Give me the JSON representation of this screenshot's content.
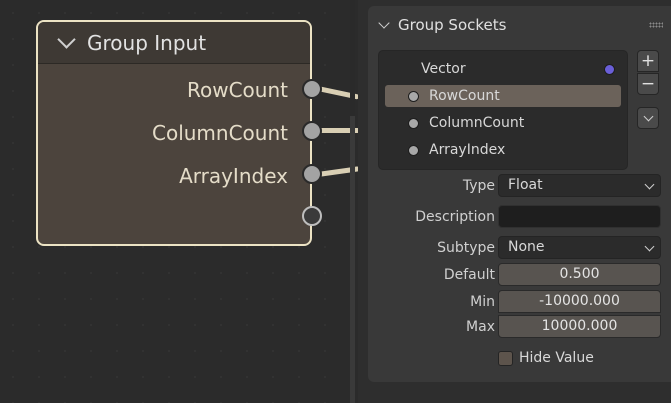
{
  "node": {
    "title": "Group Input",
    "outputs": [
      "RowCount",
      "ColumnCount",
      "ArrayIndex"
    ]
  },
  "panel": {
    "section_title": "Group Sockets",
    "sockets": [
      {
        "label": "Vector",
        "dot_color": "#6a5fd8"
      },
      {
        "label": "RowCount",
        "selected": true
      },
      {
        "label": "ColumnCount"
      },
      {
        "label": "ArrayIndex"
      }
    ],
    "buttons": {
      "add": "+",
      "remove": "−"
    },
    "properties": {
      "type_label": "Type",
      "type_value": "Float",
      "description_label": "Description",
      "description_value": "",
      "subtype_label": "Subtype",
      "subtype_value": "None",
      "default_label": "Default",
      "default_value": "0.500",
      "min_label": "Min",
      "min_value": "-10000.000",
      "max_label": "Max",
      "max_value": "10000.000",
      "hide_value_label": "Hide Value"
    }
  },
  "colors": {
    "node_border": "#ece3c4",
    "selected_row": "#6b625a",
    "vector_socket": "#6a5fd8"
  }
}
